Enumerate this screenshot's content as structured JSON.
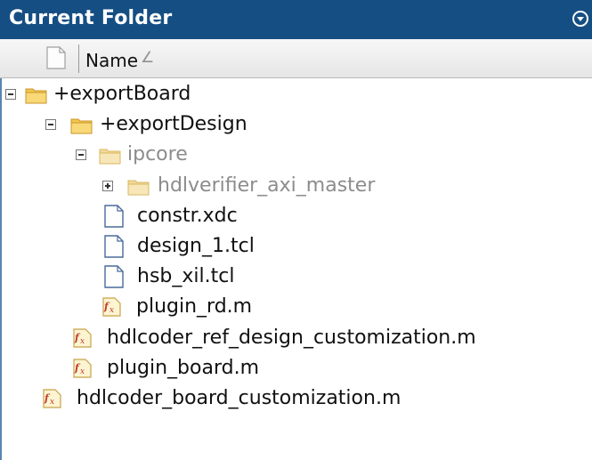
{
  "panel": {
    "title": "Current Folder",
    "column_header": "Name",
    "sort_indicator": "∠"
  },
  "tree": [
    {
      "label": "+exportBoard",
      "type": "folder",
      "state": "expanded",
      "dimmed": false
    },
    {
      "label": "+exportDesign",
      "type": "folder",
      "state": "expanded",
      "dimmed": false
    },
    {
      "label": "ipcore",
      "type": "folder",
      "state": "expanded",
      "dimmed": true
    },
    {
      "label": "hdlverifier_axi_master",
      "type": "folder",
      "state": "collapsed",
      "dimmed": true
    },
    {
      "label": "constr.xdc",
      "type": "file",
      "dimmed": false
    },
    {
      "label": "design_1.tcl",
      "type": "file",
      "dimmed": false
    },
    {
      "label": "hsb_xil.tcl",
      "type": "file",
      "dimmed": false
    },
    {
      "label": "plugin_rd.m",
      "type": "function-file",
      "dimmed": false
    },
    {
      "label": "hdlcoder_ref_design_customization.m",
      "type": "function-file",
      "dimmed": false
    },
    {
      "label": "plugin_board.m",
      "type": "function-file",
      "dimmed": false
    },
    {
      "label": "hdlcoder_board_customization.m",
      "type": "function-file",
      "dimmed": false
    }
  ],
  "colors": {
    "title_bar": "#154e83",
    "folder": "#f3c64e",
    "folder_dim": "#f2d899",
    "file_outline": "#4a6a9a",
    "fx": "#c0392b"
  },
  "icons": {
    "folder": "folder-icon",
    "file": "document-icon",
    "function-file": "function-file-icon",
    "toggle_expanded": "minus-box-icon",
    "toggle_collapsed": "plus-box-icon"
  }
}
